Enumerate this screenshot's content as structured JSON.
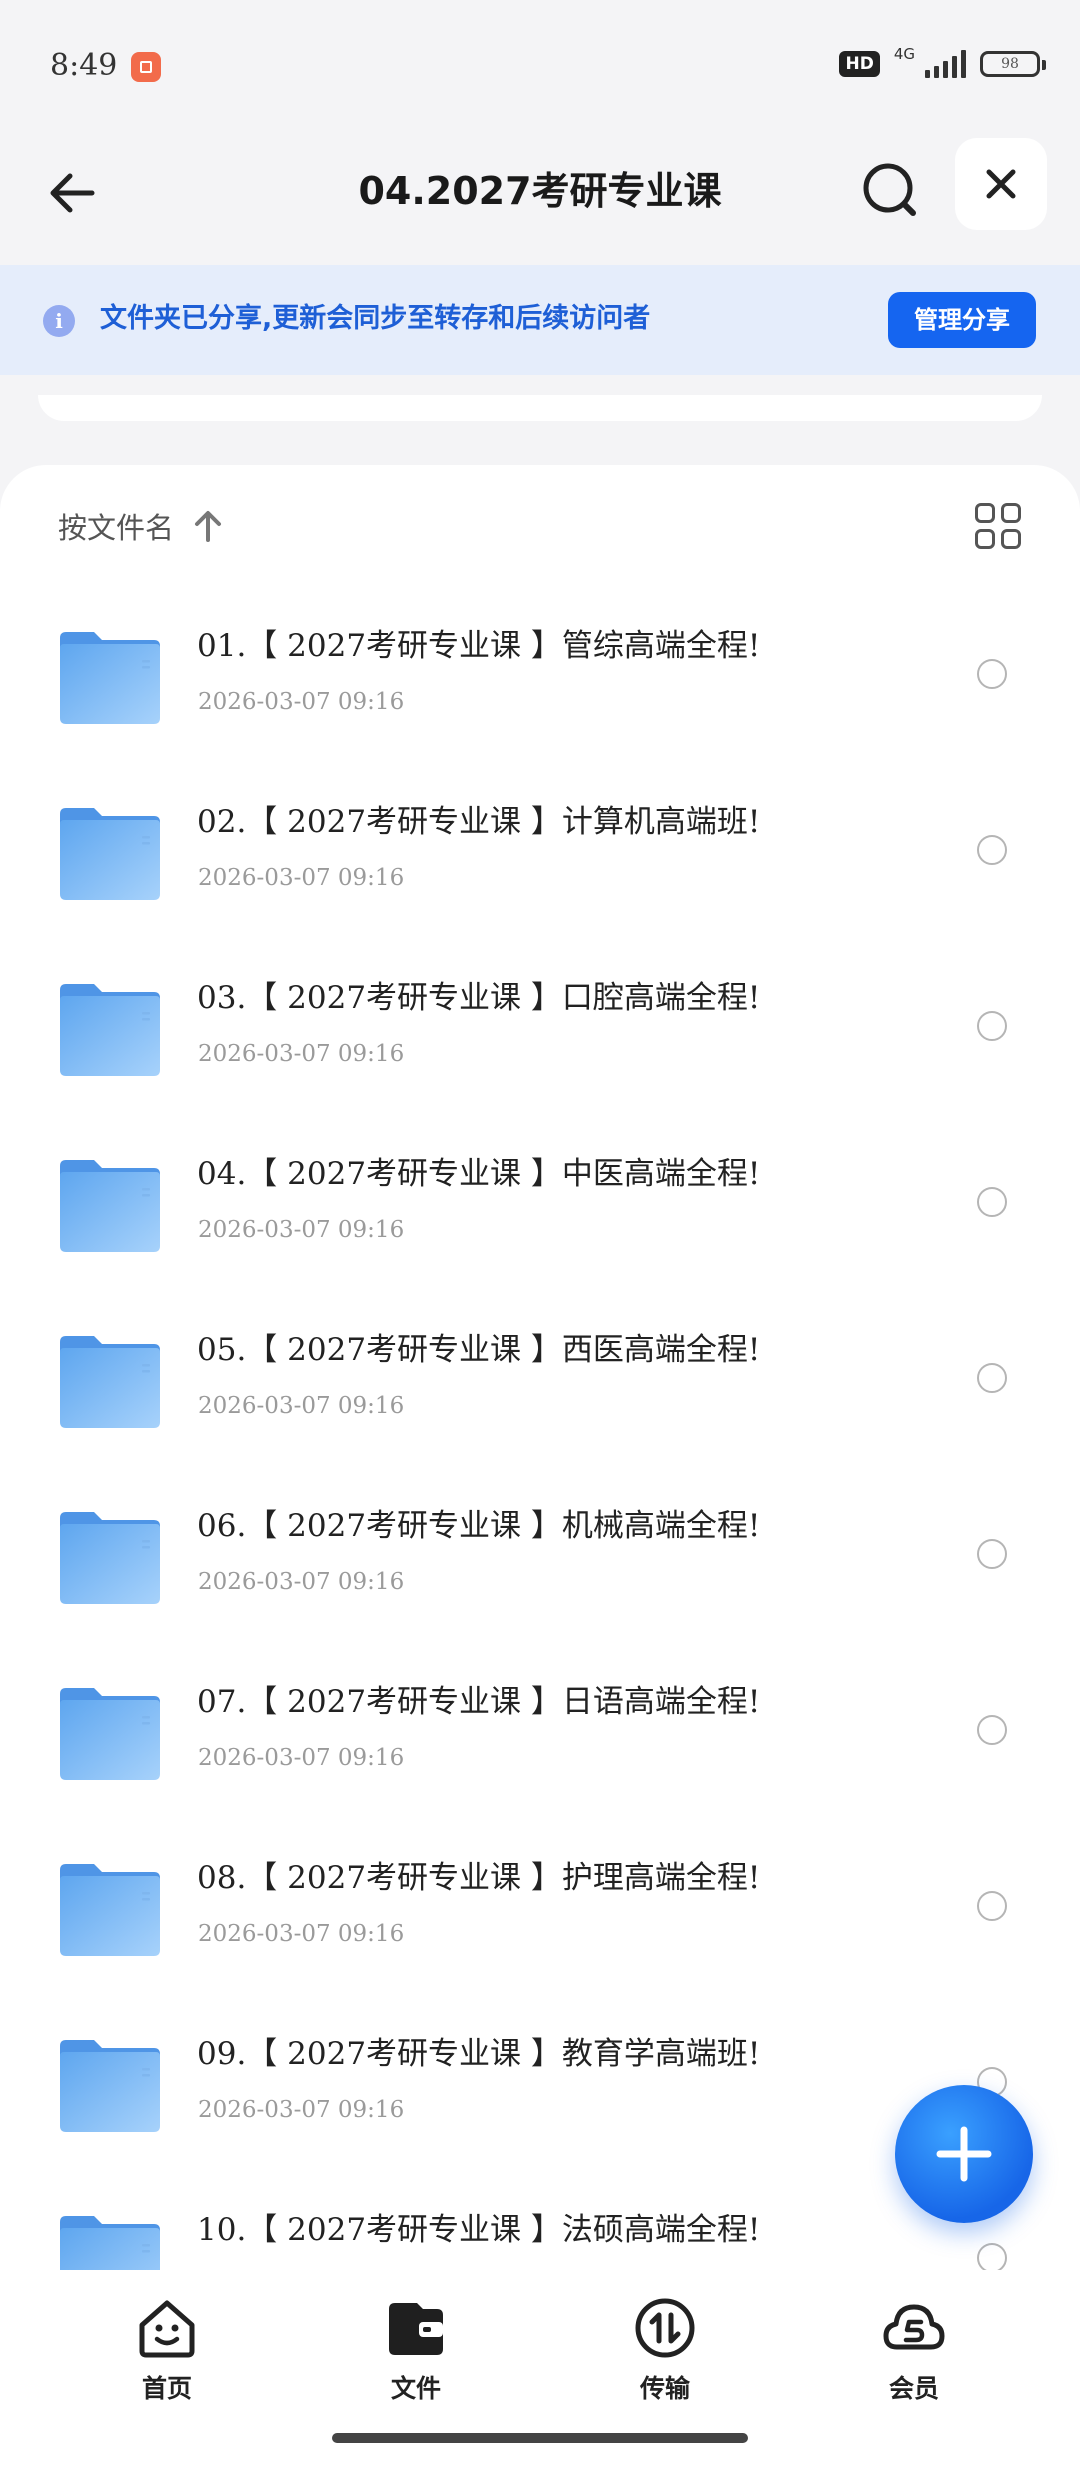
{
  "status_bar": {
    "time": "8:49",
    "hd": "HD",
    "network": "4G",
    "battery": "98"
  },
  "header": {
    "title": "04.2027考研专业课"
  },
  "banner": {
    "text": "文件夹已分享,更新会同步至转存和后续访问者",
    "manage_label": "管理分享"
  },
  "sort": {
    "label": "按文件名"
  },
  "files": [
    {
      "name": "01.【 2027考研专业课 】管综高端全程!",
      "date": "2026-03-07 09:16"
    },
    {
      "name": "02.【 2027考研专业课 】计算机高端班!",
      "date": "2026-03-07 09:16"
    },
    {
      "name": "03.【 2027考研专业课 】口腔高端全程!",
      "date": "2026-03-07 09:16"
    },
    {
      "name": "04.【 2027考研专业课 】中医高端全程!",
      "date": "2026-03-07 09:16"
    },
    {
      "name": "05.【 2027考研专业课 】西医高端全程!",
      "date": "2026-03-07 09:16"
    },
    {
      "name": "06.【 2027考研专业课 】机械高端全程!",
      "date": "2026-03-07 09:16"
    },
    {
      "name": "07.【 2027考研专业课 】日语高端全程!",
      "date": "2026-03-07 09:16"
    },
    {
      "name": "08.【 2027考研专业课 】护理高端全程!",
      "date": "2026-03-07 09:16"
    },
    {
      "name": "09.【 2027考研专业课 】教育学高端班!",
      "date": "2026-03-07 09:16"
    },
    {
      "name": "10.【 2027考研专业课 】法硕高端全程!",
      "date": ""
    }
  ],
  "nav": [
    {
      "label": "首页",
      "icon": "home-smile-icon"
    },
    {
      "label": "文件",
      "icon": "wallet-folder-icon"
    },
    {
      "label": "传输",
      "icon": "transfer-icon"
    },
    {
      "label": "会员",
      "icon": "member-cloud-icon"
    }
  ],
  "colors": {
    "accent": "#1565f0",
    "banner_bg": "#e5edfb",
    "banner_text": "#1e5fd6",
    "folder": "#6fb0f2"
  }
}
